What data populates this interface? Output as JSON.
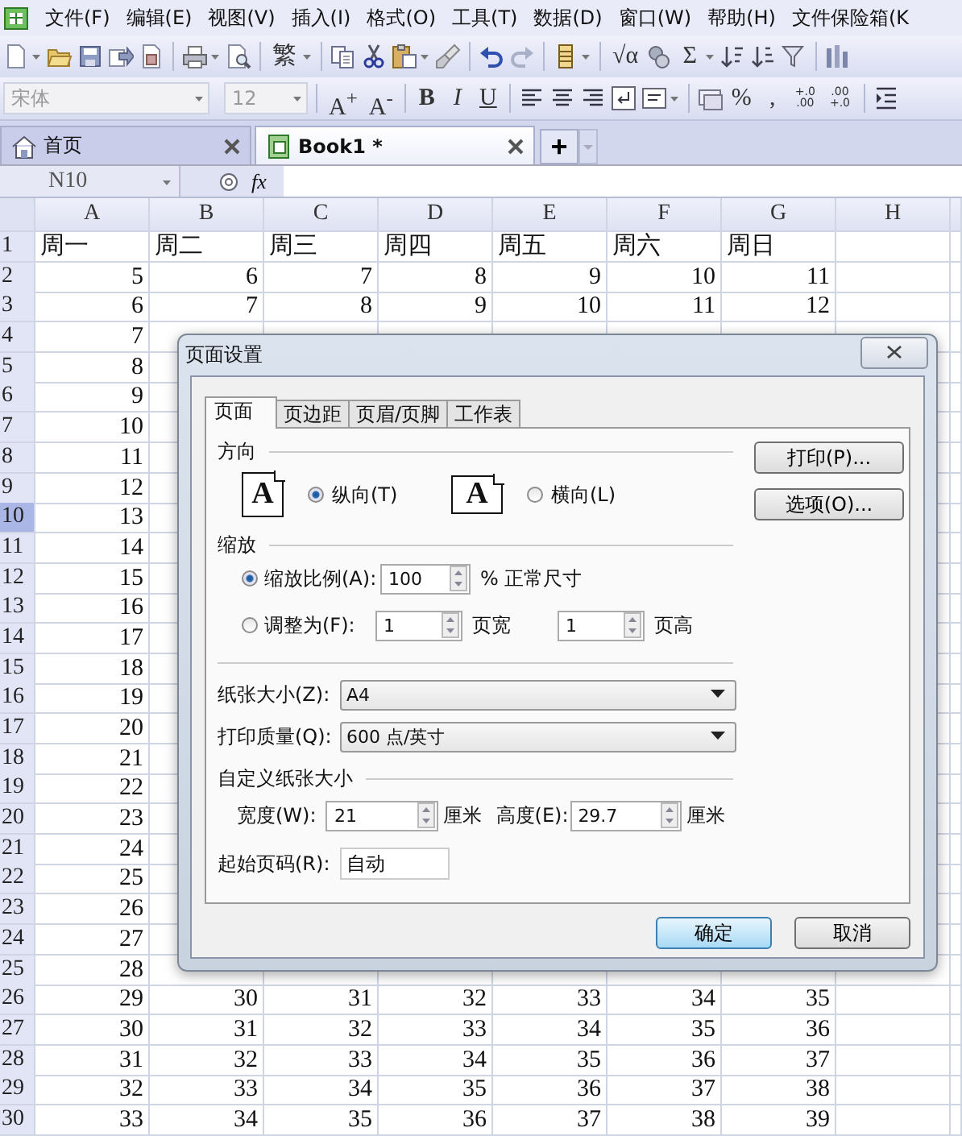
{
  "menu_bar": {
    "items": [
      "文件(F)",
      "编辑(E)",
      "视图(V)",
      "插入(I)",
      "格式(O)",
      "工具(T)",
      "数据(D)",
      "窗口(W)",
      "帮助(H)",
      "文件保险箱(K"
    ]
  },
  "toolbar_1": {
    "buttons": [
      "繁",
      "√α",
      "Σ"
    ]
  },
  "toolbar_2": {
    "font": "宋体",
    "font_size": "12",
    "buttons": [
      "A$^{+}$",
      "A$^{-}$",
      "B",
      "I",
      "U",
      "%",
      ",",
      "+.0\n.00",
      ".00\n+.0"
    ]
  },
  "tabs": [
    {
      "label": "首页",
      "selected": false
    },
    {
      "label": "Book1 *",
      "selected": true
    }
  ],
  "new_tab": "+",
  "formula_bar": {
    "cell_reference": "N10",
    "function_label": "fx"
  },
  "sheet": {
    "columns": [
      "A",
      "B",
      "C",
      "D",
      "E",
      "F",
      "G",
      "H"
    ],
    "rows": [
      {
        "label": "1",
        "selected": false,
        "kind": "text",
        "cells": [
          "周一",
          "周二",
          "周三",
          "周四",
          "周五",
          "周六",
          "周日"
        ]
      },
      {
        "label": "2",
        "selected": false,
        "kind": "number",
        "cells": [
          "5",
          "6",
          "7",
          "8",
          "9",
          "10",
          "11"
        ]
      },
      {
        "label": "3",
        "selected": false,
        "kind": "number",
        "cells": [
          "6",
          "7",
          "8",
          "9",
          "10",
          "11",
          "12"
        ]
      },
      {
        "label": "4",
        "selected": false,
        "kind": "number",
        "cells": [
          "7"
        ]
      },
      {
        "label": "5",
        "selected": false,
        "kind": "number",
        "cells": [
          "8"
        ]
      },
      {
        "label": "6",
        "selected": false,
        "kind": "number",
        "cells": [
          "9"
        ]
      },
      {
        "label": "7",
        "selected": false,
        "kind": "number",
        "cells": [
          "10"
        ]
      },
      {
        "label": "8",
        "selected": false,
        "kind": "number",
        "cells": [
          "11"
        ]
      },
      {
        "label": "9",
        "selected": false,
        "kind": "number",
        "cells": [
          "12"
        ]
      },
      {
        "label": "10",
        "selected": true,
        "kind": "number",
        "cells": [
          "13"
        ]
      },
      {
        "label": "11",
        "selected": false,
        "kind": "number",
        "cells": [
          "14"
        ]
      },
      {
        "label": "12",
        "selected": false,
        "kind": "number",
        "cells": [
          "15"
        ]
      },
      {
        "label": "13",
        "selected": false,
        "kind": "number",
        "cells": [
          "16"
        ]
      },
      {
        "label": "14",
        "selected": false,
        "kind": "number",
        "cells": [
          "17"
        ]
      },
      {
        "label": "15",
        "selected": false,
        "kind": "number",
        "cells": [
          "18"
        ]
      },
      {
        "label": "16",
        "selected": false,
        "kind": "number",
        "cells": [
          "19"
        ]
      },
      {
        "label": "17",
        "selected": false,
        "kind": "number",
        "cells": [
          "20"
        ]
      },
      {
        "label": "18",
        "selected": false,
        "kind": "number",
        "cells": [
          "21"
        ]
      },
      {
        "label": "19",
        "selected": false,
        "kind": "number",
        "cells": [
          "22"
        ]
      },
      {
        "label": "20",
        "selected": false,
        "kind": "number",
        "cells": [
          "23"
        ]
      },
      {
        "label": "21",
        "selected": false,
        "kind": "number",
        "cells": [
          "24"
        ]
      },
      {
        "label": "22",
        "selected": false,
        "kind": "number",
        "cells": [
          "25"
        ]
      },
      {
        "label": "23",
        "selected": false,
        "kind": "number",
        "cells": [
          "26"
        ]
      },
      {
        "label": "24",
        "selected": false,
        "kind": "number",
        "cells": [
          "27"
        ]
      },
      {
        "label": "25",
        "selected": false,
        "kind": "number",
        "cells": [
          "28"
        ]
      },
      {
        "label": "26",
        "selected": false,
        "kind": "number",
        "cells": [
          "29",
          "30",
          "31",
          "32",
          "33",
          "34",
          "35"
        ]
      },
      {
        "label": "27",
        "selected": false,
        "kind": "number",
        "cells": [
          "30",
          "31",
          "32",
          "33",
          "34",
          "35",
          "36"
        ]
      },
      {
        "label": "28",
        "selected": false,
        "kind": "number",
        "cells": [
          "31",
          "32",
          "33",
          "34",
          "35",
          "36",
          "37"
        ]
      },
      {
        "label": "29",
        "selected": false,
        "kind": "number",
        "cells": [
          "32",
          "33",
          "34",
          "35",
          "36",
          "37",
          "38"
        ]
      },
      {
        "label": "30",
        "selected": false,
        "kind": "number",
        "cells": [
          "33",
          "34",
          "35",
          "36",
          "37",
          "38",
          "39"
        ]
      }
    ]
  },
  "dialog": {
    "title": "页面设置",
    "tabs": [
      {
        "label": "页面",
        "selected": true
      },
      {
        "label": "页边距",
        "selected": false
      },
      {
        "label": "页眉/页脚",
        "selected": false
      },
      {
        "label": "工作表",
        "selected": false
      }
    ],
    "orientation": {
      "heading": "方向",
      "options": [
        {
          "glyph": "A",
          "label": "纵向(T)",
          "selected": true
        },
        {
          "glyph": "A",
          "label": "横向(L)",
          "selected": false
        }
      ]
    },
    "scaling": {
      "heading": "缩放",
      "options": [
        {
          "label": "缩放比例(A):",
          "selected": true,
          "fields": [
            {
              "value": "100",
              "unit": "% 正常尺寸"
            }
          ]
        },
        {
          "label": "调整为(F):",
          "selected": false,
          "fields": [
            {
              "value": "1",
              "unit": "页宽"
            },
            {
              "value": "1",
              "unit": "页高"
            }
          ]
        }
      ]
    },
    "paper_size": {
      "label": "纸张大小(Z):",
      "value": "A4"
    },
    "print_quality": {
      "label": "打印质量(Q):",
      "value": "600 点/英寸"
    },
    "custom_size": {
      "heading": "自定义纸张大小",
      "fields": [
        {
          "label": "宽度(W):",
          "value": "21",
          "unit": "厘米"
        },
        {
          "label": "高度(E):",
          "value": "29.7",
          "unit": "厘米"
        }
      ]
    },
    "first_page_number": {
      "label": "起始页码(R):",
      "value": "自动"
    },
    "side_buttons": [
      "打印(P)...",
      "选项(O)..."
    ],
    "buttons": [
      {
        "label": "确定",
        "default": true
      },
      {
        "label": "取消",
        "default": false
      }
    ]
  }
}
